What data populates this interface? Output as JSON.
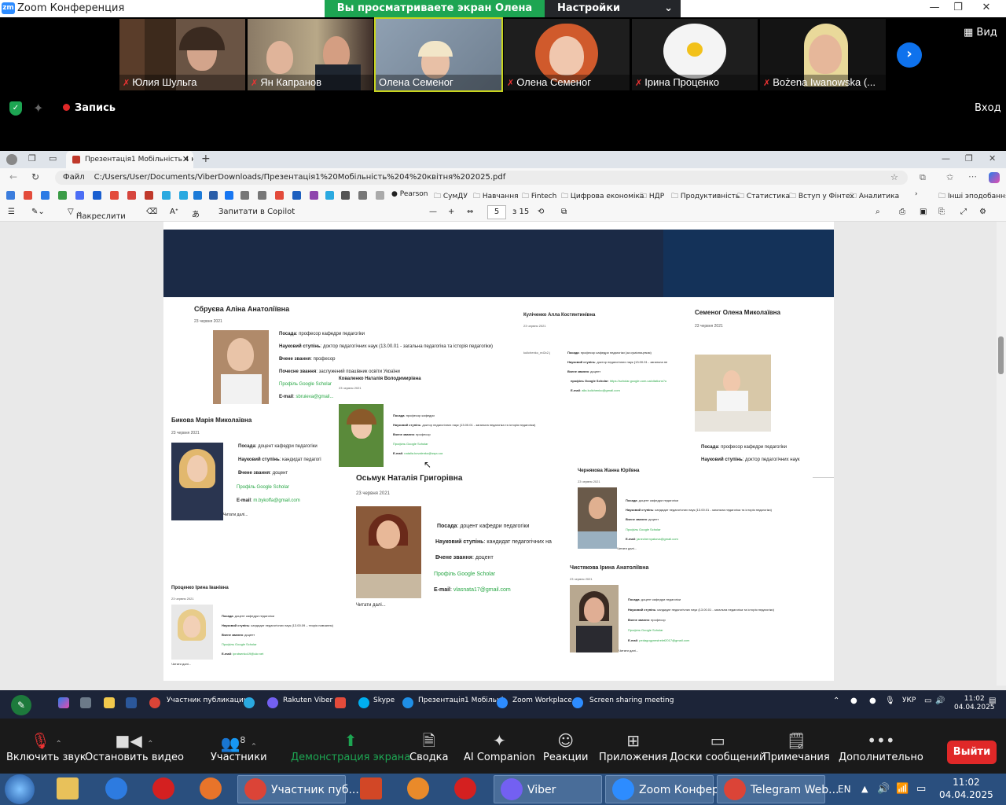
{
  "zoom": {
    "app_title": "Zoom Конференция",
    "share_banner": "Вы просматриваете экран Олена Семеног",
    "view_options": "Настройки просмотра",
    "view_button": "Вид",
    "record": "Запись",
    "login": "Вход",
    "participants": [
      {
        "name": "Юлия Шульга",
        "muted": true
      },
      {
        "name": "Ян Капранов",
        "muted": true
      },
      {
        "name": "Олена Семеног",
        "muted": false
      },
      {
        "name": "Олена Семеног",
        "muted": true
      },
      {
        "name": "Ірина Проценко",
        "muted": true
      },
      {
        "name": "Bożena Iwanowska (...",
        "muted": true
      }
    ]
  },
  "browser": {
    "tab_title": "Презентація1 Мобільність 4 кв",
    "address_label": "Файл",
    "address": "C:/Users/User/Documents/ViberDownloads/Презентація1%20Мобільність%204%20квітня%202025.pdf",
    "bookmarks": [
      "Pearson",
      "СумДУ",
      "Навчання",
      "Fintech",
      "Цифрова економіка",
      "НДР",
      "Продуктивність",
      "Статистика",
      "Вступ у Фінтех",
      "Аналитика",
      "Інші эподобання"
    ],
    "pdf_toolbar": {
      "draw": "Накреслити",
      "copilot": "Запитати в Copilot",
      "page": "5",
      "page_total": "з 15"
    }
  },
  "slide": {
    "people": [
      {
        "name": "Сбруєва Аліна Анатоліївна",
        "date": "23 червня 2021",
        "lines": [
          [
            "Посада",
            "професор кафедри педагогіки"
          ],
          [
            "Науковий ступінь",
            "доктор педагогічних наук (13.00.01 - загальна педагогіка та історія педагогіки)"
          ],
          [
            "Вчене звання",
            "професор"
          ],
          [
            "Почесне звання",
            "заслужений працівник освіти України"
          ]
        ],
        "scholar": "Профіль Google Scholar",
        "email_label": "E-mail",
        "email": "sbruieva@gmail..."
      },
      {
        "name": "Куліченко Алла Костянтинівна",
        "date": "23 червня 2021",
        "img": "kulichenko_ed2c2.j",
        "lines": [
          [
            "Посада",
            "професор кафедри педагогіки (за сумісництвом)"
          ],
          [
            "Науковий ступінь",
            "доктор педагогічних наук (13.00.01 - загальна пе"
          ],
          [
            "Вчене звання",
            "доцент"
          ]
        ],
        "scholar_label": "профіль Google Scholar",
        "scholar": "https://scholar.google.com.ua/citations?u",
        "email_label": "E-mail",
        "email": "alla.kulichenko@gmail.com"
      },
      {
        "name": "Семеног Олена Миколаївна",
        "date": "23 червня 2021",
        "lines": [
          [
            "Посада",
            "професор кафедри педагогіки"
          ],
          [
            "Науковий ступінь",
            "доктор педагогічних наук"
          ]
        ]
      },
      {
        "name": "Коваленко Наталія Володимирівна",
        "date": "23 червня 2021",
        "lines": [
          [
            "Посада",
            "професор кафедри"
          ],
          [
            "Науковий ступінь",
            "доктор педагогічних наук (13.00.01 - загальна педагогіка та історія педагогіки)"
          ],
          [
            "Вчене звання",
            "професор"
          ]
        ],
        "scholar": "Профіль Google Scholar",
        "email_label": "E-mail",
        "email": "natalia.kovalenko@sspu.ua"
      },
      {
        "name": "Бикова Марія Миколаївна",
        "date": "23 червня 2021",
        "lines": [
          [
            "Посада",
            "доцент кафедри педагогіки"
          ],
          [
            "Науковий ступінь",
            "кандидат педагогі"
          ],
          [
            "Вчене звання",
            "доцент"
          ]
        ],
        "scholar": "Профіль Google Scholar",
        "email_label": "E-mail",
        "email": "m.bykoffa@gmail.com",
        "read_more": "Читати далі..."
      },
      {
        "name": "Осьмук Наталія Григорівна",
        "date": "23 червня 2021",
        "lines": [
          [
            "Посада",
            "доцент кафедри педагогіки"
          ],
          [
            "Науковий ступінь",
            "кандидат педагогічних на"
          ],
          [
            "Вчене звання",
            "доцент"
          ]
        ],
        "scholar": "Профіль Google Scholar",
        "email_label": "E-mail",
        "email": "vlasnata17@gmail.com",
        "read_more": "Читати далі..."
      },
      {
        "name": "Чернякова Жанна Юріївна",
        "date": "23 червня 2021",
        "lines": [
          [
            "Посада",
            "доцент кафедри педагогіки"
          ],
          [
            "Науковий ступінь",
            "кандидат педагогічних наук (13.00.01 - загальна педагогіка та історія педагогіки)"
          ],
          [
            "Вчене звання",
            "доцент"
          ]
        ],
        "scholar": "Профіль Google Scholar",
        "email_label": "E-mail",
        "email": "janechernyakova@gmail.com",
        "read_more": "Читати далі..."
      },
      {
        "name": "Проценко Ірина Іванівна",
        "date": "23 червня 2021",
        "lines": [
          [
            "Посада",
            "доцент кафедри педагогіки"
          ],
          [
            "Науковий ступінь",
            "кандидат педагогічних наук (13.00.09 – теорія навчання)"
          ],
          [
            "Вчене звання",
            "доцент"
          ]
        ],
        "scholar": "Профіль Google Scholar",
        "email_label": "E-mail",
        "email": "iprotsenko19@ukr.net",
        "read_more": "Читати далі..."
      },
      {
        "name": "Чистякова Ірина Анатоліївна",
        "date": "23 червня 2021",
        "lines": [
          [
            "Посада",
            "доцент кафедри педагогіки"
          ],
          [
            "Науковий ступінь",
            "кандидат педагогічних наук (13.00.01 - загальна педагогіка та історія педагогіки)"
          ],
          [
            "Вчене звання",
            "професор"
          ]
        ],
        "scholar": "Профіль Google Scholar",
        "email_label": "E-mail",
        "email": "pedagogynestrelet2017@gmail.com",
        "read_more": "Читати далі..."
      }
    ]
  },
  "win_tasks": [
    "Участник публикации",
    "Rakuten Viber",
    "Skype",
    "Презентація1 Мобільні",
    "Zoom Workplace",
    "Screen sharing meeting"
  ],
  "win_tray": {
    "lang": "УКР",
    "time": "11:02",
    "date": "04.04.2025"
  },
  "zoom_controls": {
    "mute": "Включить звук",
    "video": "Остановить видео",
    "participants": "Участники",
    "participants_count": "8",
    "share": "Демонстрация экрана",
    "summary": "Сводка",
    "ai": "AI Companion",
    "reactions": "Реакции",
    "apps": "Приложения",
    "boards": "Доски сообщений",
    "notes": "Примечания",
    "more": "Дополнительно",
    "leave": "Выйти"
  },
  "taskbar": {
    "items": [
      "Участник пуб...",
      "Viber",
      "Zoom Конфер...",
      "Telegram Web..."
    ],
    "lang": "EN",
    "time": "11:02",
    "date": "04.04.2025"
  }
}
